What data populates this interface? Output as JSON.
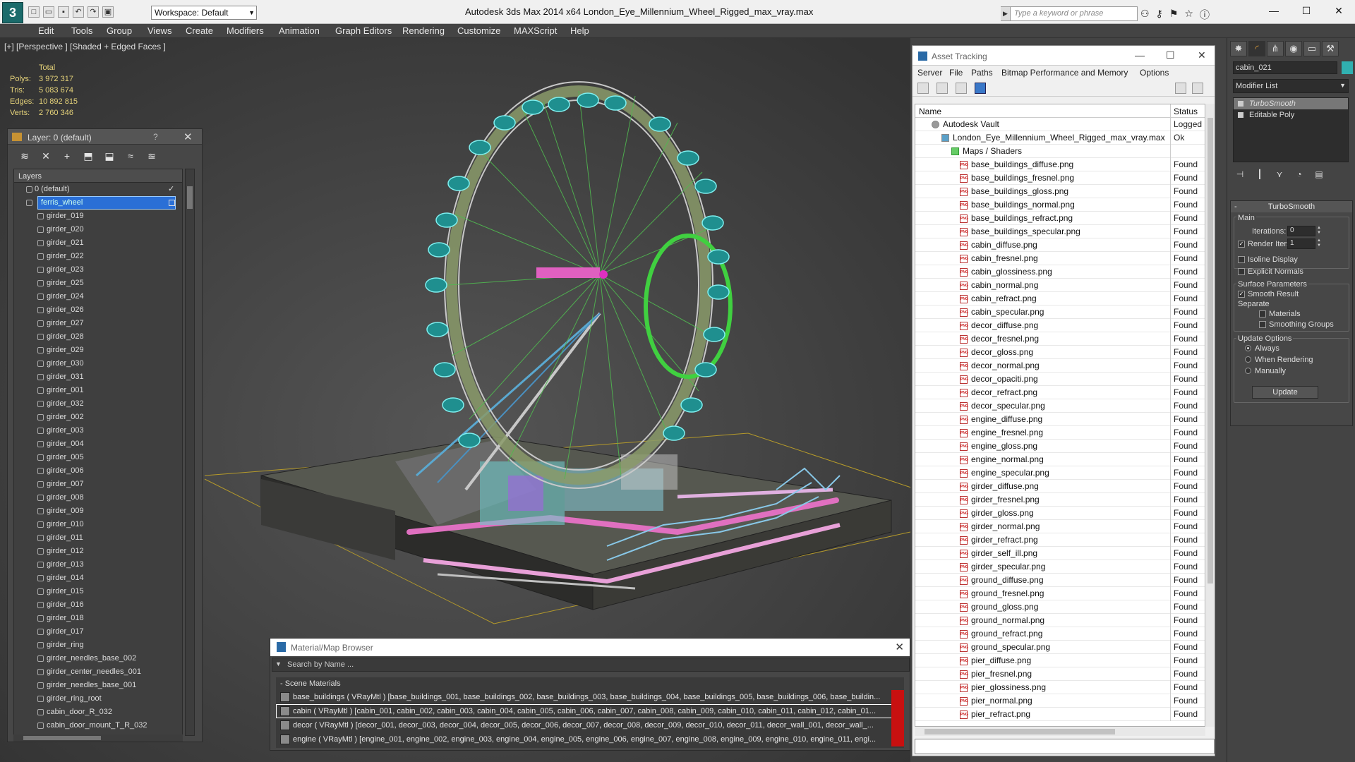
{
  "window": {
    "title": "Autodesk 3ds Max  2014 x64     London_Eye_Millennium_Wheel_Rigged_max_vray.max",
    "workspace": "Workspace: Default",
    "search_placeholder": "Type a keyword or phrase",
    "logo": "3",
    "minimize": "—",
    "maximize": "☐",
    "close": "✕"
  },
  "menu": [
    "Edit",
    "Tools",
    "Group",
    "Views",
    "Create",
    "Modifiers",
    "Animation",
    "Graph Editors",
    "Rendering",
    "Customize",
    "MAXScript",
    "Help"
  ],
  "viewport": {
    "label": "[+] [Perspective ] [Shaded + Edged Faces ]",
    "stats": {
      "header": "Total",
      "rows": [
        {
          "label": "Polys:",
          "value": "3 972 317"
        },
        {
          "label": "Tris:",
          "value": "5 083 674"
        },
        {
          "label": "Edges:",
          "value": "10 892 815"
        },
        {
          "label": "Verts:",
          "value": "2 760 346"
        }
      ]
    }
  },
  "layer_panel": {
    "title": "Layer: 0 (default)",
    "help": "?",
    "close": "✕",
    "header": "Layers",
    "layers": [
      {
        "name": "0 (default)",
        "level": 1,
        "checked": true
      },
      {
        "name": "ferris_wheel",
        "level": 1,
        "selected": true
      },
      {
        "name": "girder_019",
        "level": 2
      },
      {
        "name": "girder_020",
        "level": 2
      },
      {
        "name": "girder_021",
        "level": 2
      },
      {
        "name": "girder_022",
        "level": 2
      },
      {
        "name": "girder_023",
        "level": 2
      },
      {
        "name": "girder_025",
        "level": 2
      },
      {
        "name": "girder_024",
        "level": 2
      },
      {
        "name": "girder_026",
        "level": 2
      },
      {
        "name": "girder_027",
        "level": 2
      },
      {
        "name": "girder_028",
        "level": 2
      },
      {
        "name": "girder_029",
        "level": 2
      },
      {
        "name": "girder_030",
        "level": 2
      },
      {
        "name": "girder_031",
        "level": 2
      },
      {
        "name": "girder_001",
        "level": 2
      },
      {
        "name": "girder_032",
        "level": 2
      },
      {
        "name": "girder_002",
        "level": 2
      },
      {
        "name": "girder_003",
        "level": 2
      },
      {
        "name": "girder_004",
        "level": 2
      },
      {
        "name": "girder_005",
        "level": 2
      },
      {
        "name": "girder_006",
        "level": 2
      },
      {
        "name": "girder_007",
        "level": 2
      },
      {
        "name": "girder_008",
        "level": 2
      },
      {
        "name": "girder_009",
        "level": 2
      },
      {
        "name": "girder_010",
        "level": 2
      },
      {
        "name": "girder_011",
        "level": 2
      },
      {
        "name": "girder_012",
        "level": 2
      },
      {
        "name": "girder_013",
        "level": 2
      },
      {
        "name": "girder_014",
        "level": 2
      },
      {
        "name": "girder_015",
        "level": 2
      },
      {
        "name": "girder_016",
        "level": 2
      },
      {
        "name": "girder_018",
        "level": 2
      },
      {
        "name": "girder_017",
        "level": 2
      },
      {
        "name": "girder_ring",
        "level": 2
      },
      {
        "name": "girder_needles_base_002",
        "level": 2
      },
      {
        "name": "girder_center_needles_001",
        "level": 2
      },
      {
        "name": "girder_needles_base_001",
        "level": 2
      },
      {
        "name": "girder_ring_root",
        "level": 2
      },
      {
        "name": "cabin_door_R_032",
        "level": 2
      },
      {
        "name": "cabin_door_mount_T_R_032",
        "level": 2
      }
    ]
  },
  "asset_tracking": {
    "title": "Asset Tracking",
    "menu": [
      "Server",
      "File",
      "Paths",
      "Bitmap Performance and Memory",
      "Options"
    ],
    "col_name": "Name",
    "col_status": "Status",
    "rows": [
      {
        "name": "Autodesk Vault",
        "status": "Logged",
        "level": 1,
        "kind": "vault"
      },
      {
        "name": "London_Eye_Millennium_Wheel_Rigged_max_vray.max",
        "status": "Ok",
        "level": 2,
        "kind": "file"
      },
      {
        "name": "Maps / Shaders",
        "status": "",
        "level": 3,
        "kind": "folder"
      },
      {
        "name": "base_buildings_diffuse.png",
        "status": "Found",
        "level": 4,
        "kind": "png"
      },
      {
        "name": "base_buildings_fresnel.png",
        "status": "Found",
        "level": 4,
        "kind": "png"
      },
      {
        "name": "base_buildings_gloss.png",
        "status": "Found",
        "level": 4,
        "kind": "png"
      },
      {
        "name": "base_buildings_normal.png",
        "status": "Found",
        "level": 4,
        "kind": "png"
      },
      {
        "name": "base_buildings_refract.png",
        "status": "Found",
        "level": 4,
        "kind": "png"
      },
      {
        "name": "base_buildings_specular.png",
        "status": "Found",
        "level": 4,
        "kind": "png"
      },
      {
        "name": "cabin_diffuse.png",
        "status": "Found",
        "level": 4,
        "kind": "png"
      },
      {
        "name": "cabin_fresnel.png",
        "status": "Found",
        "level": 4,
        "kind": "png"
      },
      {
        "name": "cabin_glossiness.png",
        "status": "Found",
        "level": 4,
        "kind": "png"
      },
      {
        "name": "cabin_normal.png",
        "status": "Found",
        "level": 4,
        "kind": "png"
      },
      {
        "name": "cabin_refract.png",
        "status": "Found",
        "level": 4,
        "kind": "png"
      },
      {
        "name": "cabin_specular.png",
        "status": "Found",
        "level": 4,
        "kind": "png"
      },
      {
        "name": "decor_diffuse.png",
        "status": "Found",
        "level": 4,
        "kind": "png"
      },
      {
        "name": "decor_fresnel.png",
        "status": "Found",
        "level": 4,
        "kind": "png"
      },
      {
        "name": "decor_gloss.png",
        "status": "Found",
        "level": 4,
        "kind": "png"
      },
      {
        "name": "decor_normal.png",
        "status": "Found",
        "level": 4,
        "kind": "png"
      },
      {
        "name": "decor_opaciti.png",
        "status": "Found",
        "level": 4,
        "kind": "png"
      },
      {
        "name": "decor_refract.png",
        "status": "Found",
        "level": 4,
        "kind": "png"
      },
      {
        "name": "decor_specular.png",
        "status": "Found",
        "level": 4,
        "kind": "png"
      },
      {
        "name": "engine_diffuse.png",
        "status": "Found",
        "level": 4,
        "kind": "png"
      },
      {
        "name": "engine_fresnel.png",
        "status": "Found",
        "level": 4,
        "kind": "png"
      },
      {
        "name": "engine_gloss.png",
        "status": "Found",
        "level": 4,
        "kind": "png"
      },
      {
        "name": "engine_normal.png",
        "status": "Found",
        "level": 4,
        "kind": "png"
      },
      {
        "name": "engine_specular.png",
        "status": "Found",
        "level": 4,
        "kind": "png"
      },
      {
        "name": "girder_diffuse.png",
        "status": "Found",
        "level": 4,
        "kind": "png"
      },
      {
        "name": "girder_fresnel.png",
        "status": "Found",
        "level": 4,
        "kind": "png"
      },
      {
        "name": "girder_gloss.png",
        "status": "Found",
        "level": 4,
        "kind": "png"
      },
      {
        "name": "girder_normal.png",
        "status": "Found",
        "level": 4,
        "kind": "png"
      },
      {
        "name": "girder_refract.png",
        "status": "Found",
        "level": 4,
        "kind": "png"
      },
      {
        "name": "girder_self_ill.png",
        "status": "Found",
        "level": 4,
        "kind": "png"
      },
      {
        "name": "girder_specular.png",
        "status": "Found",
        "level": 4,
        "kind": "png"
      },
      {
        "name": "ground_diffuse.png",
        "status": "Found",
        "level": 4,
        "kind": "png"
      },
      {
        "name": "ground_fresnel.png",
        "status": "Found",
        "level": 4,
        "kind": "png"
      },
      {
        "name": "ground_gloss.png",
        "status": "Found",
        "level": 4,
        "kind": "png"
      },
      {
        "name": "ground_normal.png",
        "status": "Found",
        "level": 4,
        "kind": "png"
      },
      {
        "name": "ground_refract.png",
        "status": "Found",
        "level": 4,
        "kind": "png"
      },
      {
        "name": "ground_specular.png",
        "status": "Found",
        "level": 4,
        "kind": "png"
      },
      {
        "name": "pier_diffuse.png",
        "status": "Found",
        "level": 4,
        "kind": "png"
      },
      {
        "name": "pier_fresnel.png",
        "status": "Found",
        "level": 4,
        "kind": "png"
      },
      {
        "name": "pier_glossiness.png",
        "status": "Found",
        "level": 4,
        "kind": "png"
      },
      {
        "name": "pier_normal.png",
        "status": "Found",
        "level": 4,
        "kind": "png"
      },
      {
        "name": "pier_refract.png",
        "status": "Found",
        "level": 4,
        "kind": "png"
      }
    ]
  },
  "material_browser": {
    "title": "Material/Map Browser",
    "search": "Search by Name ...",
    "section": "- Scene Materials",
    "items": [
      {
        "text": "base_buildings ( VRayMtl ) [base_buildings_001, base_buildings_002, base_buildings_003, base_buildings_004, base_buildings_005, base_buildings_006, base_buildin..."
      },
      {
        "text": "cabin  ( VRayMtl )  [cabin_001, cabin_002, cabin_003, cabin_004, cabin_005, cabin_006, cabin_007, cabin_008, cabin_009, cabin_010, cabin_011, cabin_012, cabin_01...",
        "selected": true
      },
      {
        "text": "decor  ( VRayMtl )  [decor_001, decor_003, decor_004, decor_005, decor_006, decor_007, decor_008, decor_009, decor_010, decor_011, decor_wall_001, decor_wall_..."
      },
      {
        "text": "engine  ( VRayMtl )  [engine_001, engine_002, engine_003, engine_004, engine_005, engine_006, engine_007, engine_008, engine_009, engine_010, engine_011, engi..."
      }
    ]
  },
  "command_panel": {
    "object_name": "cabin_021",
    "object_color": "#30b0b0",
    "modifier_list": "Modifier List",
    "stack": [
      "TurboSmooth",
      "Editable Poly"
    ],
    "rollout_title": "TurboSmooth",
    "main_label": "Main",
    "iterations_label": "Iterations:",
    "iterations_value": "0",
    "render_iters_label": "Render Iters:",
    "render_iters_value": "1",
    "render_iters_checked": true,
    "isoline_label": "Isoline Display",
    "explicit_label": "Explicit Normals",
    "surface_label": "Surface Parameters",
    "smooth_label": "Smooth Result",
    "separate_label": "Separate",
    "materials_label": "Materials",
    "smoothing_label": "Smoothing Groups",
    "update_options_label": "Update Options",
    "always_label": "Always",
    "when_rendering_label": "When Rendering",
    "manually_label": "Manually",
    "update_button": "Update"
  }
}
